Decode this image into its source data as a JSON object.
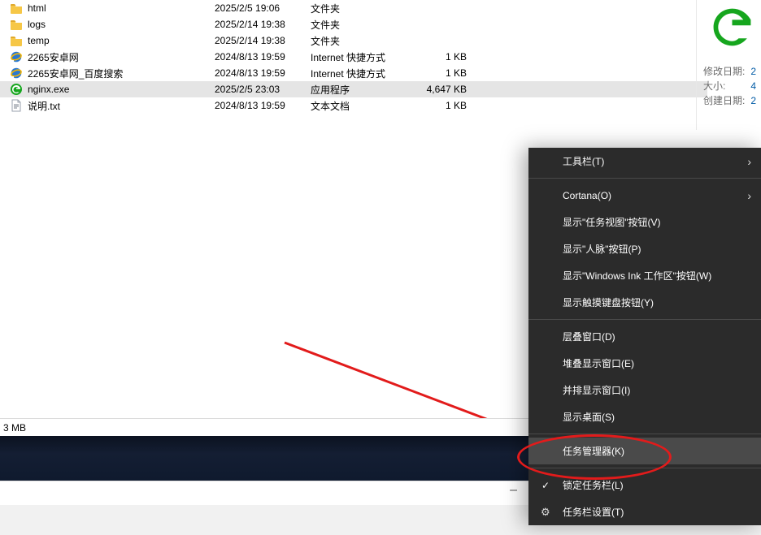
{
  "files": [
    {
      "icon": "folder",
      "name": "html",
      "date": "2025/2/5 19:06",
      "type": "文件夹",
      "size": ""
    },
    {
      "icon": "folder",
      "name": "logs",
      "date": "2025/2/14 19:38",
      "type": "文件夹",
      "size": ""
    },
    {
      "icon": "folder",
      "name": "temp",
      "date": "2025/2/14 19:38",
      "type": "文件夹",
      "size": ""
    },
    {
      "icon": "ie",
      "name": "2265安卓网",
      "date": "2024/8/13 19:59",
      "type": "Internet 快捷方式",
      "size": "1 KB"
    },
    {
      "icon": "ie",
      "name": "2265安卓网_百度搜索",
      "date": "2024/8/13 19:59",
      "type": "Internet 快捷方式",
      "size": "1 KB"
    },
    {
      "icon": "exe",
      "name": "nginx.exe",
      "date": "2025/2/5 23:03",
      "type": "应用程序",
      "size": "4,647 KB",
      "selected": true
    },
    {
      "icon": "txt",
      "name": "说明.txt",
      "date": "2024/8/13 19:59",
      "type": "文本文档",
      "size": "1 KB"
    }
  ],
  "details": {
    "meta": [
      {
        "label": "修改日期:",
        "value": "2"
      },
      {
        "label": "大小:",
        "value": "4"
      },
      {
        "label": "创建日期:",
        "value": "2"
      }
    ]
  },
  "status": {
    "text": "3 MB"
  },
  "context_menu": {
    "groups": [
      [
        {
          "label": "工具栏(T)",
          "submenu": true
        }
      ],
      [
        {
          "label": "Cortana(O)",
          "submenu": true
        },
        {
          "label": "显示\"任务视图\"按钮(V)"
        },
        {
          "label": "显示\"人脉\"按钮(P)"
        },
        {
          "label": "显示\"Windows Ink 工作区\"按钮(W)"
        },
        {
          "label": "显示触摸键盘按钮(Y)"
        }
      ],
      [
        {
          "label": "层叠窗口(D)"
        },
        {
          "label": "堆叠显示窗口(E)"
        },
        {
          "label": "并排显示窗口(I)"
        },
        {
          "label": "显示桌面(S)"
        }
      ],
      [
        {
          "label": "任务管理器(K)",
          "highlight": true
        }
      ],
      [
        {
          "label": "锁定任务栏(L)",
          "checked": true
        },
        {
          "label": "任务栏设置(T)",
          "gear": true
        }
      ]
    ]
  },
  "lower_dash": "–"
}
